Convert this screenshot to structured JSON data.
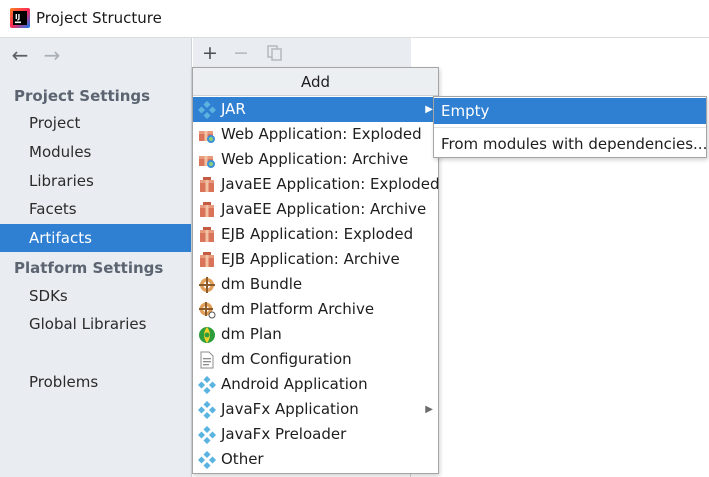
{
  "window": {
    "title": "Project Structure"
  },
  "nav": {
    "back": "←",
    "forward": "→"
  },
  "sidebar": {
    "project_settings_heading": "Project Settings",
    "platform_settings_heading": "Platform Settings",
    "items": {
      "project": "Project",
      "modules": "Modules",
      "libraries": "Libraries",
      "facets": "Facets",
      "artifacts": "Artifacts",
      "sdks": "SDKs",
      "global_libraries": "Global Libraries",
      "problems": "Problems"
    },
    "selected": "Artifacts"
  },
  "toolbar": {
    "add": "+",
    "remove": "−"
  },
  "popup": {
    "title": "Add",
    "items": [
      {
        "label": "JAR",
        "icon": "jar-icon",
        "submenu": true
      },
      {
        "label": "Web Application: Exploded",
        "icon": "web-app-icon"
      },
      {
        "label": "Web Application: Archive",
        "icon": "web-app-icon"
      },
      {
        "label": "JavaEE Application: Exploded",
        "icon": "javaee-app-icon"
      },
      {
        "label": "JavaEE Application: Archive",
        "icon": "javaee-app-icon"
      },
      {
        "label": "EJB Application: Exploded",
        "icon": "ejb-app-icon"
      },
      {
        "label": "EJB Application: Archive",
        "icon": "ejb-app-icon"
      },
      {
        "label": "dm Bundle",
        "icon": "dm-bundle-icon"
      },
      {
        "label": "dm Platform Archive",
        "icon": "dm-platform-archive-icon"
      },
      {
        "label": "dm Plan",
        "icon": "dm-plan-icon"
      },
      {
        "label": "dm Configuration",
        "icon": "dm-configuration-icon"
      },
      {
        "label": "Android Application",
        "icon": "android-app-icon"
      },
      {
        "label": "JavaFx Application",
        "icon": "javafx-app-icon",
        "submenu": true
      },
      {
        "label": "JavaFx Preloader",
        "icon": "javafx-preloader-icon"
      },
      {
        "label": "Other",
        "icon": "other-icon"
      }
    ],
    "submenu_arrow": "▶"
  },
  "submenu": {
    "items": [
      {
        "label": "Empty"
      },
      {
        "label": "From modules with dependencies..."
      }
    ]
  },
  "colors": {
    "selection": "#2f7fd2",
    "sidebar_bg": "#e9edf1"
  }
}
